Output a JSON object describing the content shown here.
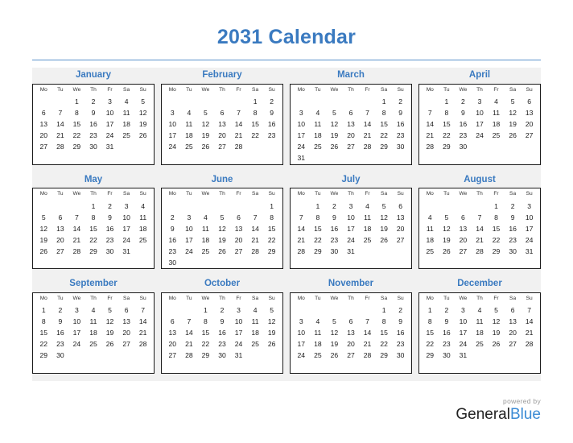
{
  "title": "2031 Calendar",
  "colors": {
    "accent_blue": "#3a7ac0",
    "rule_blue": "#5b93cc",
    "band_gray": "#f1f1f1",
    "box_border": "#1a1a1a",
    "brand_blue": "#3a8ad4",
    "brand_dark": "#222222",
    "powered_gray": "#9a9a9a"
  },
  "weekday_headers": [
    "Mo",
    "Tu",
    "We",
    "Th",
    "Fr",
    "Sa",
    "Su"
  ],
  "footer": {
    "powered_by": "powered by",
    "brand_first": "General",
    "brand_second": "Blue"
  },
  "months": [
    {
      "name": "January",
      "weeks": [
        [
          "",
          "",
          "1",
          "2",
          "3",
          "4",
          "5"
        ],
        [
          "6",
          "7",
          "8",
          "9",
          "10",
          "11",
          "12"
        ],
        [
          "13",
          "14",
          "15",
          "16",
          "17",
          "18",
          "19"
        ],
        [
          "20",
          "21",
          "22",
          "23",
          "24",
          "25",
          "26"
        ],
        [
          "27",
          "28",
          "29",
          "30",
          "31",
          "",
          ""
        ],
        [
          "",
          "",
          "",
          "",
          "",
          "",
          ""
        ]
      ]
    },
    {
      "name": "February",
      "weeks": [
        [
          "",
          "",
          "",
          "",
          "",
          "1",
          "2"
        ],
        [
          "3",
          "4",
          "5",
          "6",
          "7",
          "8",
          "9"
        ],
        [
          "10",
          "11",
          "12",
          "13",
          "14",
          "15",
          "16"
        ],
        [
          "17",
          "18",
          "19",
          "20",
          "21",
          "22",
          "23"
        ],
        [
          "24",
          "25",
          "26",
          "27",
          "28",
          "",
          ""
        ],
        [
          "",
          "",
          "",
          "",
          "",
          "",
          ""
        ]
      ]
    },
    {
      "name": "March",
      "weeks": [
        [
          "",
          "",
          "",
          "",
          "",
          "1",
          "2"
        ],
        [
          "3",
          "4",
          "5",
          "6",
          "7",
          "8",
          "9"
        ],
        [
          "10",
          "11",
          "12",
          "13",
          "14",
          "15",
          "16"
        ],
        [
          "17",
          "18",
          "19",
          "20",
          "21",
          "22",
          "23"
        ],
        [
          "24",
          "25",
          "26",
          "27",
          "28",
          "29",
          "30"
        ],
        [
          "31",
          "",
          "",
          "",
          "",
          "",
          ""
        ]
      ]
    },
    {
      "name": "April",
      "weeks": [
        [
          "",
          "1",
          "2",
          "3",
          "4",
          "5",
          "6"
        ],
        [
          "7",
          "8",
          "9",
          "10",
          "11",
          "12",
          "13"
        ],
        [
          "14",
          "15",
          "16",
          "17",
          "18",
          "19",
          "20"
        ],
        [
          "21",
          "22",
          "23",
          "24",
          "25",
          "26",
          "27"
        ],
        [
          "28",
          "29",
          "30",
          "",
          "",
          "",
          ""
        ],
        [
          "",
          "",
          "",
          "",
          "",
          "",
          ""
        ]
      ]
    },
    {
      "name": "May",
      "weeks": [
        [
          "",
          "",
          "",
          "1",
          "2",
          "3",
          "4"
        ],
        [
          "5",
          "6",
          "7",
          "8",
          "9",
          "10",
          "11"
        ],
        [
          "12",
          "13",
          "14",
          "15",
          "16",
          "17",
          "18"
        ],
        [
          "19",
          "20",
          "21",
          "22",
          "23",
          "24",
          "25"
        ],
        [
          "26",
          "27",
          "28",
          "29",
          "30",
          "31",
          ""
        ],
        [
          "",
          "",
          "",
          "",
          "",
          "",
          ""
        ]
      ]
    },
    {
      "name": "June",
      "weeks": [
        [
          "",
          "",
          "",
          "",
          "",
          "",
          "1"
        ],
        [
          "2",
          "3",
          "4",
          "5",
          "6",
          "7",
          "8"
        ],
        [
          "9",
          "10",
          "11",
          "12",
          "13",
          "14",
          "15"
        ],
        [
          "16",
          "17",
          "18",
          "19",
          "20",
          "21",
          "22"
        ],
        [
          "23",
          "24",
          "25",
          "26",
          "27",
          "28",
          "29"
        ],
        [
          "30",
          "",
          "",
          "",
          "",
          "",
          ""
        ]
      ]
    },
    {
      "name": "July",
      "weeks": [
        [
          "",
          "1",
          "2",
          "3",
          "4",
          "5",
          "6"
        ],
        [
          "7",
          "8",
          "9",
          "10",
          "11",
          "12",
          "13"
        ],
        [
          "14",
          "15",
          "16",
          "17",
          "18",
          "19",
          "20"
        ],
        [
          "21",
          "22",
          "23",
          "24",
          "25",
          "26",
          "27"
        ],
        [
          "28",
          "29",
          "30",
          "31",
          "",
          "",
          ""
        ],
        [
          "",
          "",
          "",
          "",
          "",
          "",
          ""
        ]
      ]
    },
    {
      "name": "August",
      "weeks": [
        [
          "",
          "",
          "",
          "",
          "1",
          "2",
          "3"
        ],
        [
          "4",
          "5",
          "6",
          "7",
          "8",
          "9",
          "10"
        ],
        [
          "11",
          "12",
          "13",
          "14",
          "15",
          "16",
          "17"
        ],
        [
          "18",
          "19",
          "20",
          "21",
          "22",
          "23",
          "24"
        ],
        [
          "25",
          "26",
          "27",
          "28",
          "29",
          "30",
          "31"
        ],
        [
          "",
          "",
          "",
          "",
          "",
          "",
          ""
        ]
      ]
    },
    {
      "name": "September",
      "weeks": [
        [
          "1",
          "2",
          "3",
          "4",
          "5",
          "6",
          "7"
        ],
        [
          "8",
          "9",
          "10",
          "11",
          "12",
          "13",
          "14"
        ],
        [
          "15",
          "16",
          "17",
          "18",
          "19",
          "20",
          "21"
        ],
        [
          "22",
          "23",
          "24",
          "25",
          "26",
          "27",
          "28"
        ],
        [
          "29",
          "30",
          "",
          "",
          "",
          "",
          ""
        ],
        [
          "",
          "",
          "",
          "",
          "",
          "",
          ""
        ]
      ]
    },
    {
      "name": "October",
      "weeks": [
        [
          "",
          "",
          "1",
          "2",
          "3",
          "4",
          "5"
        ],
        [
          "6",
          "7",
          "8",
          "9",
          "10",
          "11",
          "12"
        ],
        [
          "13",
          "14",
          "15",
          "16",
          "17",
          "18",
          "19"
        ],
        [
          "20",
          "21",
          "22",
          "23",
          "24",
          "25",
          "26"
        ],
        [
          "27",
          "28",
          "29",
          "30",
          "31",
          "",
          ""
        ],
        [
          "",
          "",
          "",
          "",
          "",
          "",
          ""
        ]
      ]
    },
    {
      "name": "November",
      "weeks": [
        [
          "",
          "",
          "",
          "",
          "",
          "1",
          "2"
        ],
        [
          "3",
          "4",
          "5",
          "6",
          "7",
          "8",
          "9"
        ],
        [
          "10",
          "11",
          "12",
          "13",
          "14",
          "15",
          "16"
        ],
        [
          "17",
          "18",
          "19",
          "20",
          "21",
          "22",
          "23"
        ],
        [
          "24",
          "25",
          "26",
          "27",
          "28",
          "29",
          "30"
        ],
        [
          "",
          "",
          "",
          "",
          "",
          "",
          ""
        ]
      ]
    },
    {
      "name": "December",
      "weeks": [
        [
          "1",
          "2",
          "3",
          "4",
          "5",
          "6",
          "7"
        ],
        [
          "8",
          "9",
          "10",
          "11",
          "12",
          "13",
          "14"
        ],
        [
          "15",
          "16",
          "17",
          "18",
          "19",
          "20",
          "21"
        ],
        [
          "22",
          "23",
          "24",
          "25",
          "26",
          "27",
          "28"
        ],
        [
          "29",
          "30",
          "31",
          "",
          "",
          "",
          ""
        ],
        [
          "",
          "",
          "",
          "",
          "",
          "",
          ""
        ]
      ]
    }
  ]
}
